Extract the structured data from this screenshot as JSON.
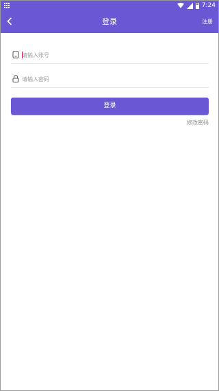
{
  "status_bar": {
    "time": "7:24",
    "icons": [
      "app-grid-icon",
      "wifi-icon",
      "signal-icon",
      "battery-icon"
    ]
  },
  "app_bar": {
    "back_icon": "chevron-left-icon",
    "title": "登录",
    "register_label": "注册"
  },
  "form": {
    "account": {
      "icon": "phone-icon",
      "placeholder": "请输入账号",
      "value": ""
    },
    "password": {
      "icon": "lock-icon",
      "placeholder": "请输入密码",
      "value": ""
    },
    "login_label": "登录",
    "change_password_label": "修改密码"
  },
  "colors": {
    "primary": "#6a57d4",
    "caret": "#d81b60",
    "link": "#8a8a8a"
  }
}
